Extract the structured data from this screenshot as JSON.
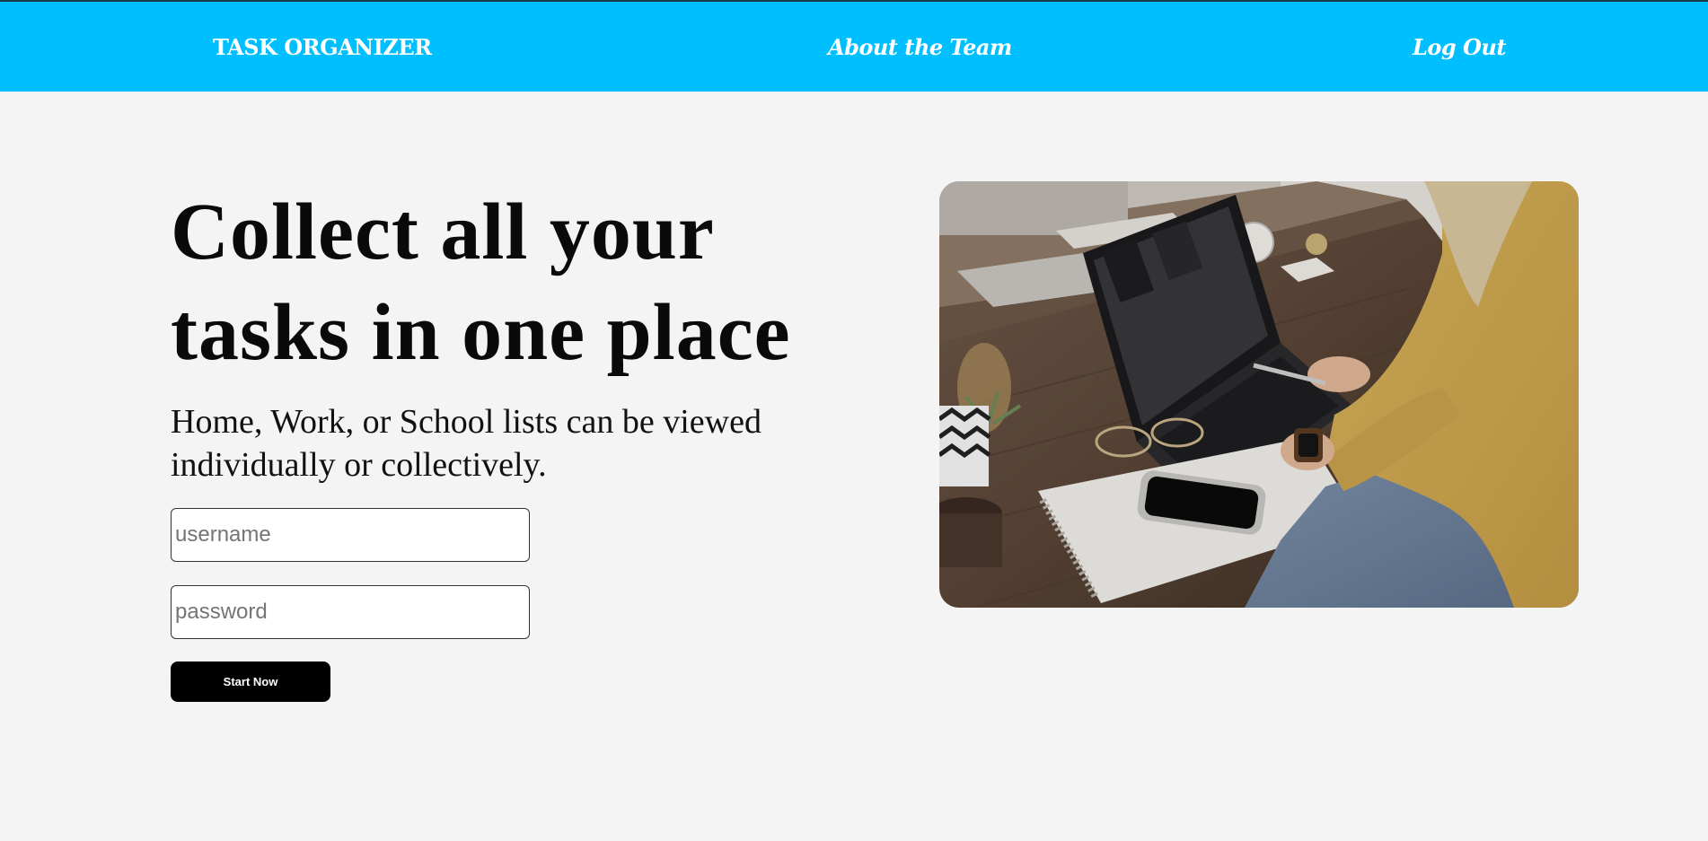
{
  "nav": {
    "brand": "TASK ORGANIZER",
    "about": "About the Team",
    "logout": "Log Out"
  },
  "hero": {
    "headline_line1": "Collect all your",
    "headline_line2": "tasks in one place",
    "subtext_line1": "Home, Work, or School lists can be viewed",
    "subtext_line2": "individually or collectively."
  },
  "form": {
    "username_placeholder": "username",
    "password_placeholder": "password",
    "submit_label": "Start Now"
  },
  "colors": {
    "nav_background": "#00bfff",
    "page_background": "#f4f4f4",
    "button_background": "#000000"
  },
  "image": {
    "semantic": "photo-person-working-on-laptop-at-desk"
  }
}
